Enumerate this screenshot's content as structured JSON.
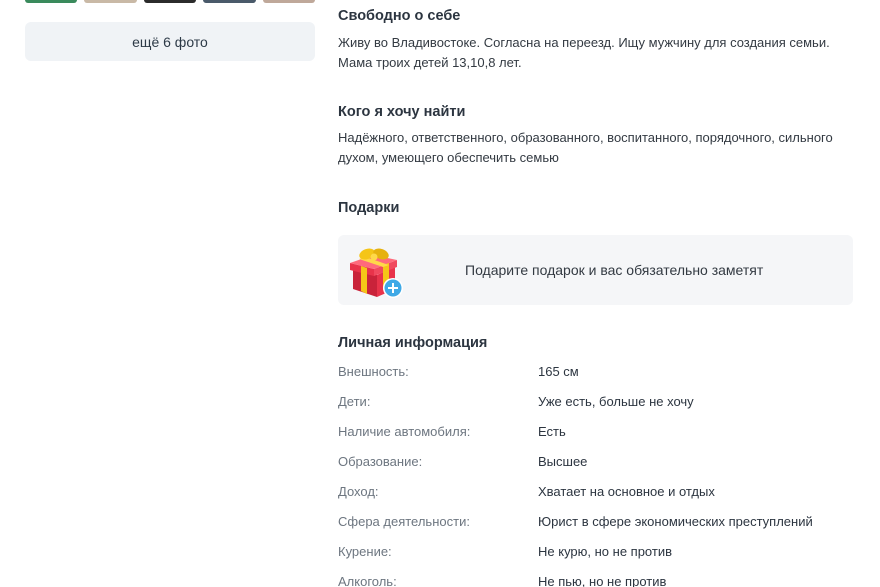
{
  "photos": {
    "thumb_colors": [
      "#3a8a5c",
      "#c9b9a6",
      "#2b2b2b",
      "#4a5a6a",
      "#bfa89a"
    ],
    "more_label": "ещё 6 фото"
  },
  "about": {
    "title": "Свободно о себе",
    "lines": [
      "Живу во Владивостоке. Согласна на переезд. Ищу мужчину для создания семьи.",
      "Мама троих детей 13,10,8 лет."
    ]
  },
  "looking_for": {
    "title": "Кого я хочу найти",
    "lines": [
      "Надёжного, ответственного, образованного, воспитанного, порядочного, сильного",
      "духом, умеющего обеспечить семью"
    ]
  },
  "gifts": {
    "title": "Подарки",
    "cta": "Подарите подарок и вас обязательно заметят",
    "icon": "gift-icon",
    "colors": {
      "box": "#e8334a",
      "ribbon": "#f5c518",
      "plus": "#3fa9e6"
    }
  },
  "personal": {
    "title": "Личная информация",
    "rows": [
      {
        "label": "Внешность:",
        "value": "165 см"
      },
      {
        "label": "Дети:",
        "value": "Уже есть, больше не хочу"
      },
      {
        "label": "Наличие автомобиля:",
        "value": "Есть"
      },
      {
        "label": "Образование:",
        "value": "Высшее"
      },
      {
        "label": "Доход:",
        "value": "Хватает на основное и отдых"
      },
      {
        "label": "Сфера деятельности:",
        "value": "Юрист в сфере экономических преступлений"
      },
      {
        "label": "Курение:",
        "value": "Не курю, но не против"
      },
      {
        "label": "Алкоголь:",
        "value": "Не пью, но не против"
      }
    ]
  }
}
